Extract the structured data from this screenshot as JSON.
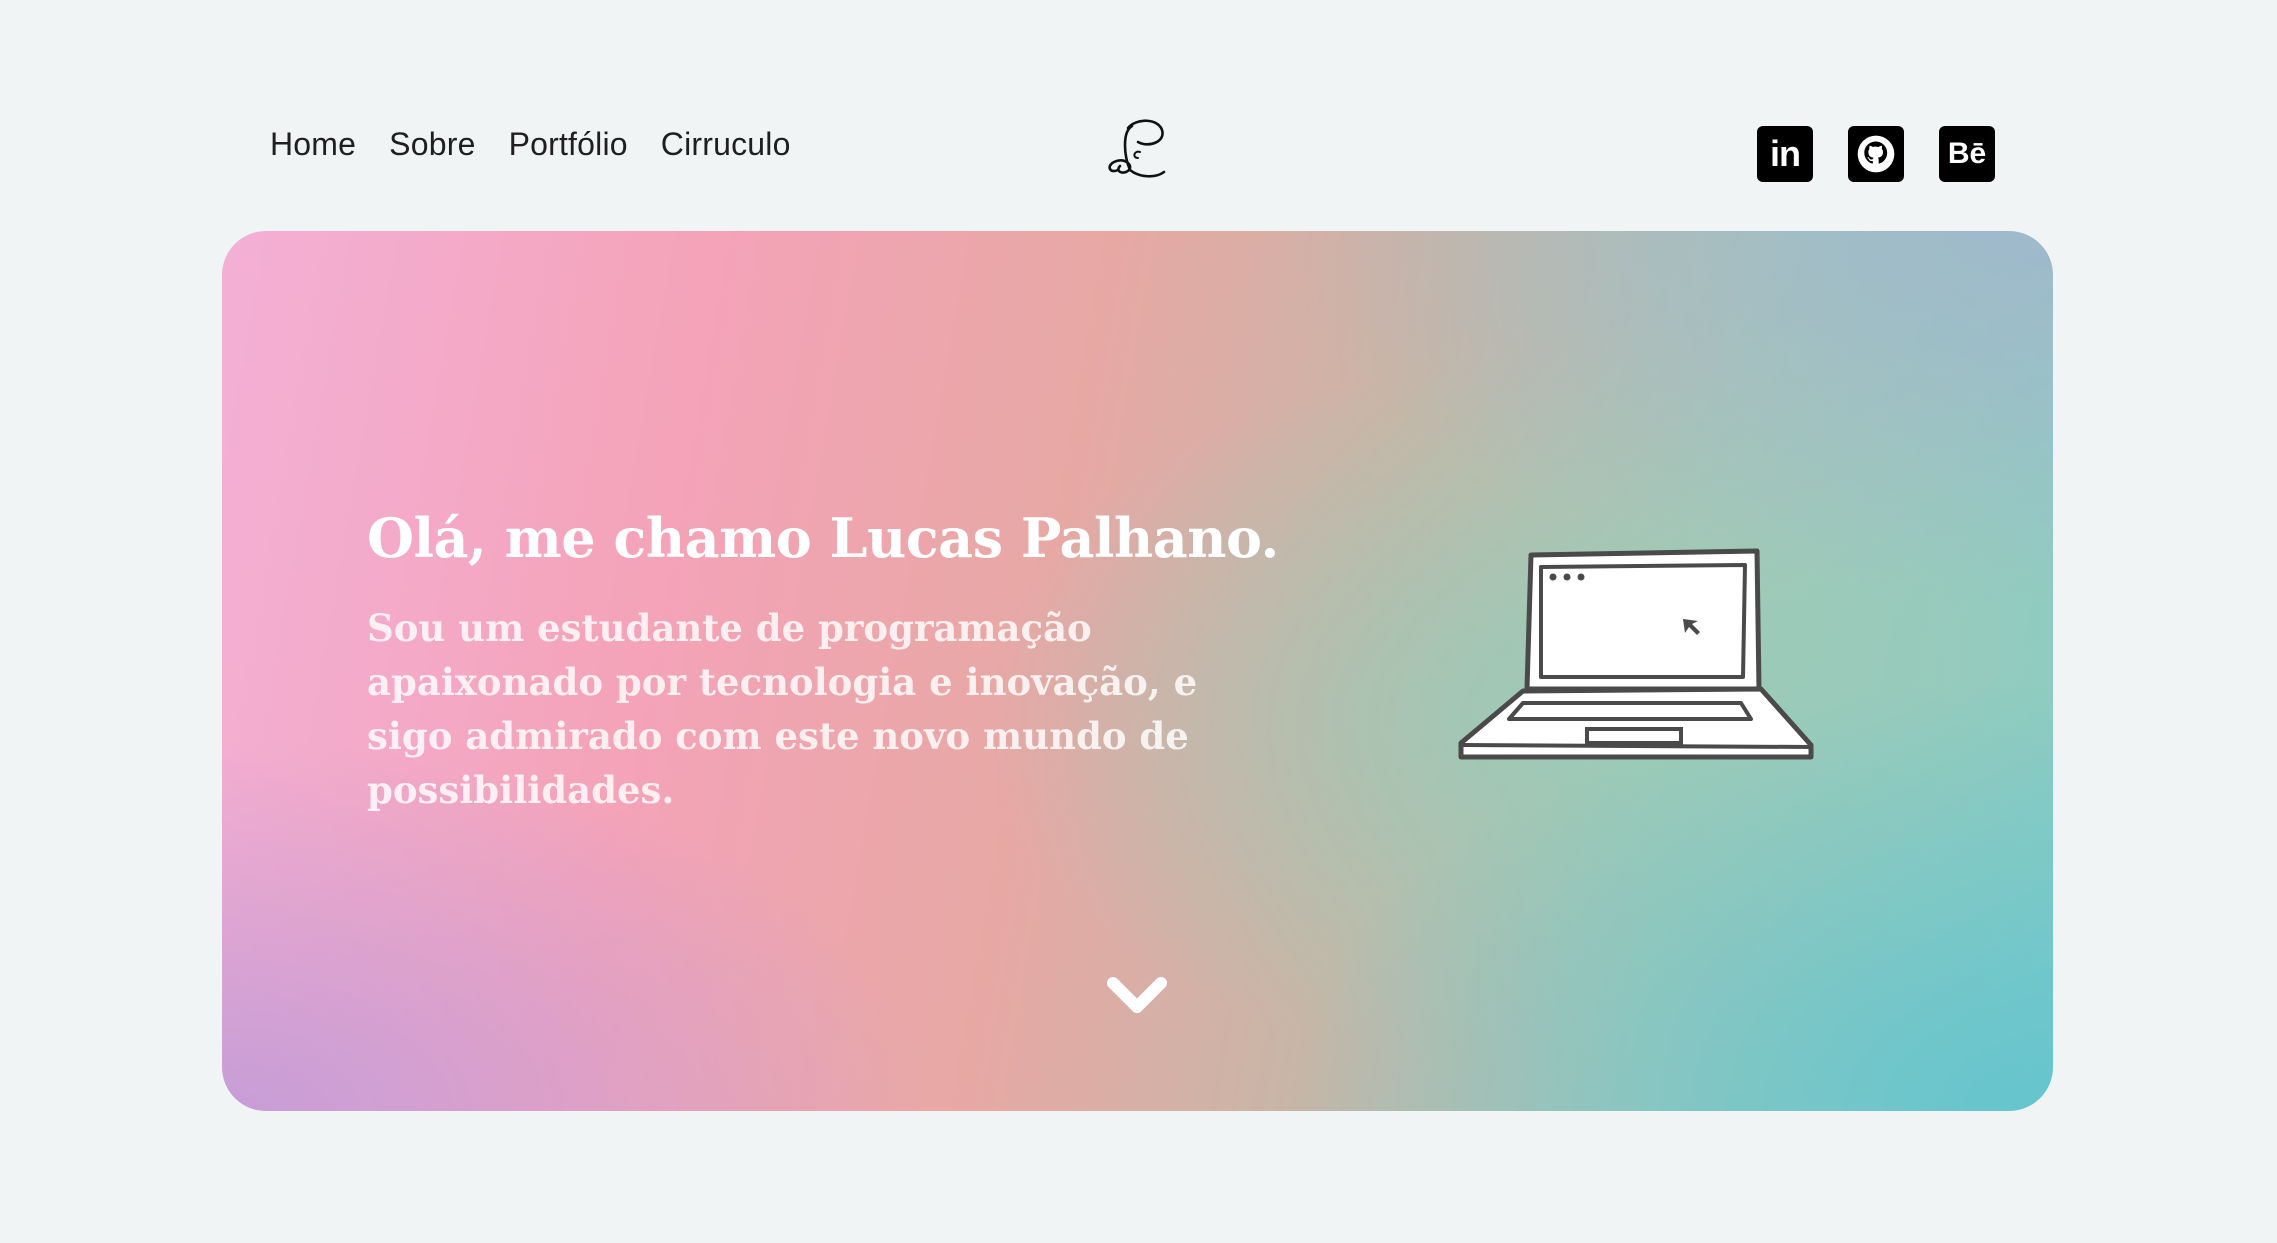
{
  "nav": {
    "items": [
      "Home",
      "Sobre",
      "Portfólio",
      "Cirruculo"
    ]
  },
  "logo": {
    "icon": "lp-monogram-icon"
  },
  "socials": {
    "items": [
      {
        "name": "linkedin",
        "label": "in"
      },
      {
        "name": "github",
        "label": ""
      },
      {
        "name": "behance",
        "label": "Bē"
      }
    ]
  },
  "hero": {
    "title": "Olá, me chamo Lucas Palhano.",
    "subtitle": "Sou um estudante de programação apaixonado por tecnologia e inovação, e sigo admirado com este novo mundo de possibilidades.",
    "illustration": "laptop-icon",
    "scroll_icon": "chevron-down-icon"
  },
  "colors": {
    "background": "#f0f4f5",
    "gradient_pink": "#f3b0d6",
    "gradient_teal": "#62c4ce",
    "gradient_purple": "#c49cd8",
    "text_dark": "#1f1f1f"
  }
}
